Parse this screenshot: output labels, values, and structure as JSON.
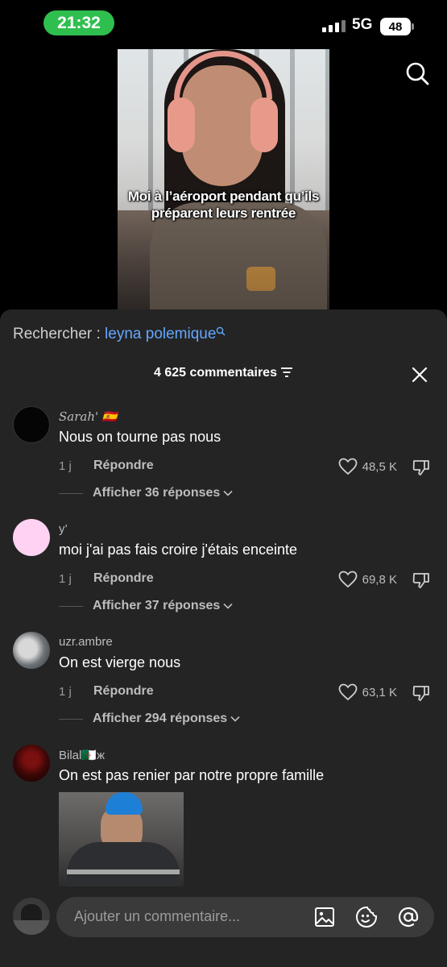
{
  "status_bar": {
    "time": "21:32",
    "network": "5G",
    "battery": "48"
  },
  "video": {
    "caption_line1": "Moi à l’aéroport pendant qu’ils",
    "caption_line2": "préparent leurs rentrée"
  },
  "search_suggestion": {
    "prefix": "Rechercher : ",
    "term": "leyna polemique"
  },
  "header": {
    "comment_count": "4 625 commentaires"
  },
  "comments": [
    {
      "username": "Sarah'",
      "flag": "🇪🇸",
      "text": "Nous on tourne pas nous",
      "age": "1 j",
      "reply_label": "Répondre",
      "likes": "48,5 K",
      "view_replies": "Afficher 36 réponses"
    },
    {
      "username": "y’",
      "flag": "",
      "text": "moi j'ai pas fais croire j'étais enceinte",
      "age": "1 j",
      "reply_label": "Répondre",
      "likes": "69,8 K",
      "view_replies": "Afficher 37 réponses"
    },
    {
      "username": "uzr.ambre",
      "flag": "",
      "text": "On est vierge nous",
      "age": "1 j",
      "reply_label": "Répondre",
      "likes": "63,1 K",
      "view_replies": "Afficher 294 réponses"
    },
    {
      "username": "Bilal",
      "flag": "🇩🇿ж",
      "text": "On est pas renier par notre propre famille"
    }
  ],
  "input": {
    "placeholder": "Ajouter un commentaire..."
  },
  "colors": {
    "accent_link": "#63a7ff",
    "time_pill": "#2fbf4f",
    "sheet_bg": "#242424"
  }
}
